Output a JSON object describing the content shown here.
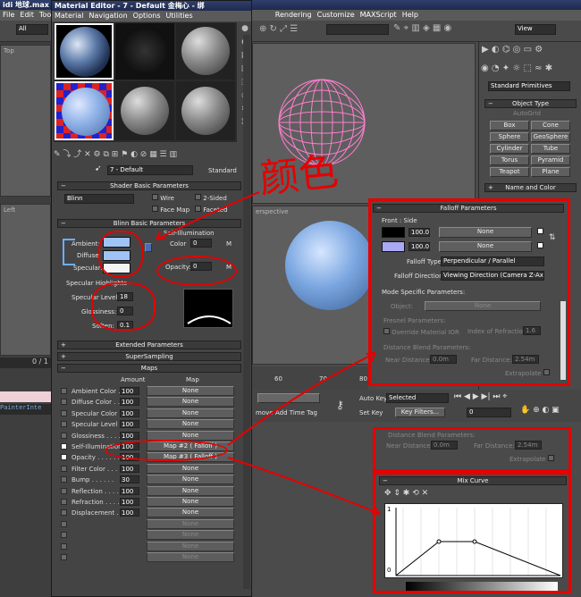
{
  "main": {
    "title": "idi 地球.max -",
    "menu": [
      "File",
      "Edit",
      "Too"
    ],
    "menu_right": [
      "Rendering",
      "Customize",
      "MAXScript",
      "Help"
    ],
    "filter": "All",
    "view_dropdown": "View",
    "vp_label_top": "Top",
    "vp_label_left": "Left",
    "vp_label_persp": "erspective",
    "frame": "0 / 1",
    "node_name": "PainterInte"
  },
  "cmd_panel": {
    "category": "Standard Primitives",
    "rollout_type": "Object Type",
    "autogrid": "AutoGrid",
    "buttons": [
      "Box",
      "Cone",
      "Sphere",
      "GeoSphere",
      "Cylinder",
      "Tube",
      "Torus",
      "Pyramid",
      "Teapot",
      "Plane"
    ],
    "rollout_name": "Name and Color"
  },
  "material_editor": {
    "title": "Material Editor - 7 - Default",
    "title_suffix": "金梅心 - 绑",
    "menu": [
      "Material",
      "Navigation",
      "Options",
      "Utilities"
    ],
    "mtl_name": "7 - Default",
    "mtl_type": "Standard",
    "shader_rollout": "Shader Basic Parameters",
    "shader": "Blinn",
    "wire": "Wire",
    "two_sided": "2-Sided",
    "face_map": "Face Map",
    "faceted": "Faceted",
    "blinn_rollout": "Blinn Basic Parameters",
    "self_illum": "Self-Illumination",
    "color_label": "Color",
    "color_val": "0",
    "ambient": "Ambient:",
    "diffuse": "Diffuse:",
    "specular": "Specular:",
    "opacity_label": "Opacity:",
    "opacity_val": "0",
    "m": "M",
    "spec_highlights": "Specular Highlights",
    "spec_level": "Specular Level:",
    "spec_level_val": "18",
    "glossiness": "Glossiness:",
    "gloss_val": "0",
    "soften": "Soften:",
    "soften_val": "0.1",
    "rollouts": [
      "Extended Parameters",
      "SuperSampling",
      "Maps"
    ],
    "maps_header_amount": "Amount",
    "maps_header_map": "Map",
    "maps": [
      {
        "name": "Ambient Color . . .",
        "amount": "100",
        "map": "None",
        "checked": false
      },
      {
        "name": "Diffuse Color . . .",
        "amount": "100",
        "map": "None",
        "checked": false
      },
      {
        "name": "Specular Color . .",
        "amount": "100",
        "map": "None",
        "checked": false
      },
      {
        "name": "Specular Level . .",
        "amount": "100",
        "map": "None",
        "checked": false
      },
      {
        "name": "Glossiness . . . .",
        "amount": "100",
        "map": "None",
        "checked": false
      },
      {
        "name": "Self-Illumination .",
        "amount": "100",
        "map": "Map #2 ( Falloff )",
        "checked": true
      },
      {
        "name": "Opacity . . . . . .",
        "amount": "100",
        "map": "Map #3 ( Falloff )",
        "checked": true
      },
      {
        "name": "Filter Color . . .",
        "amount": "100",
        "map": "None",
        "checked": false
      },
      {
        "name": "Bump . . . . . .",
        "amount": "30",
        "map": "None",
        "checked": false
      },
      {
        "name": "Reflection . . . .",
        "amount": "100",
        "map": "None",
        "checked": false
      },
      {
        "name": "Refraction . . . .",
        "amount": "100",
        "map": "None",
        "checked": false
      },
      {
        "name": "Displacement . . .",
        "amount": "100",
        "map": "None",
        "checked": false
      },
      {
        "name": "",
        "amount": "",
        "map": "None",
        "checked": false
      },
      {
        "name": "",
        "amount": "",
        "map": "None",
        "checked": false
      },
      {
        "name": "",
        "amount": "",
        "map": "None",
        "checked": false
      },
      {
        "name": "",
        "amount": "",
        "map": "None",
        "checked": false
      }
    ]
  },
  "falloff": {
    "rollout": "Falloff Parameters",
    "front_side": "Front : Side",
    "val1": "100.0",
    "val2": "100.0",
    "none1": "None",
    "none2": "None",
    "type_label": "Falloff Type:",
    "type_val": "Perpendicular / Parallel",
    "dir_label": "Falloff Direction:",
    "dir_val": "Viewing Direction (Camera Z-Axis)",
    "mode_label": "Mode Specific Parameters:",
    "object_label": "Object:",
    "object_val": "None",
    "fresnel": "Fresnel Parameters:",
    "override": "Override Material IOR",
    "ior_label": "Index of Refraction",
    "ior_val": "1.6",
    "blend": "Distance Blend Parameters:",
    "near_label": "Near Distance:",
    "near_val": "0.0m",
    "far_label": "Far Distance:",
    "far_val": "2.54m",
    "extrapolate": "Extrapolate"
  },
  "mix_curve": {
    "rollout": "Mix Curve",
    "y_top": "1",
    "y_bottom": "0"
  },
  "timeline": {
    "ticks": [
      "60",
      "70",
      "80"
    ],
    "auto_key": "Auto Key",
    "selected": "Selected",
    "set_key": "Set Key",
    "key_filters": "Key Filters...",
    "frame": "0",
    "add_time_tag": "Add Time Tag",
    "move": "move"
  },
  "annotation": {
    "text": "颜色"
  },
  "colors": {
    "ambient_swatch": "#9fc3f5",
    "diffuse_swatch": "#9fc3f5",
    "specular_swatch": "#f4f4f4",
    "falloff_swatch1": "#000000",
    "falloff_swatch2": "#a9a9f5",
    "annotation": "#e60000",
    "sphere": "#7aa6e0"
  }
}
